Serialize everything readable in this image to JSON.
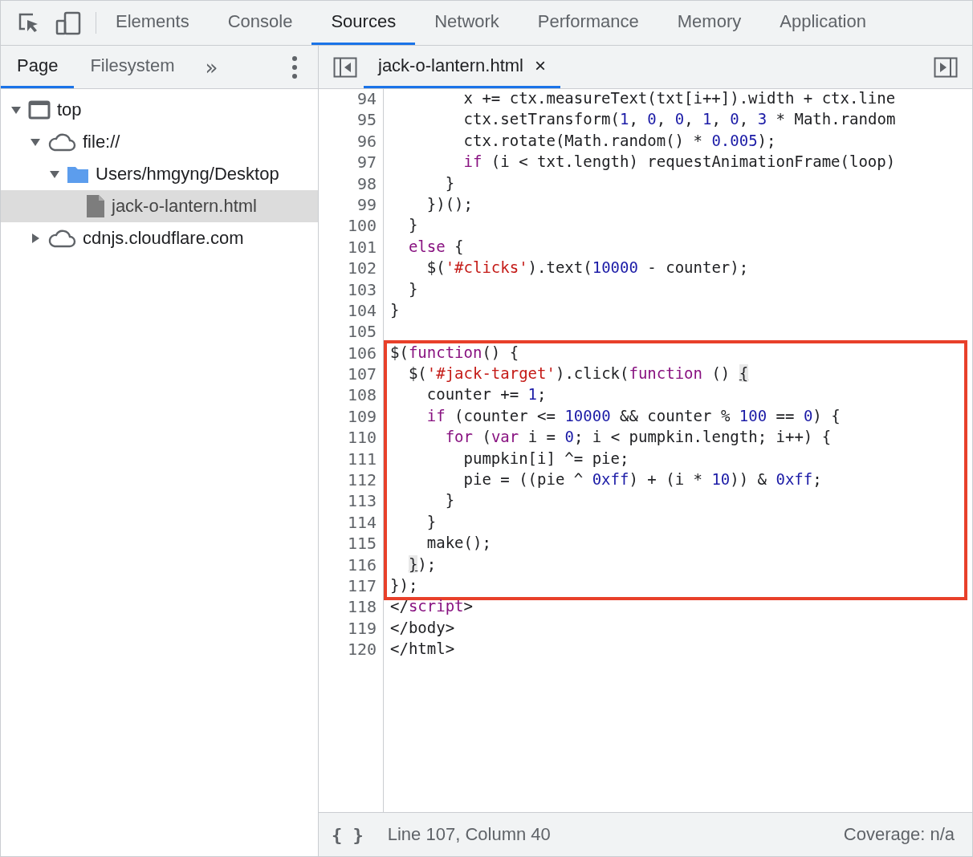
{
  "main_tabs": [
    {
      "label": "Elements",
      "selected": false
    },
    {
      "label": "Console",
      "selected": false
    },
    {
      "label": "Sources",
      "selected": true
    },
    {
      "label": "Network",
      "selected": false
    },
    {
      "label": "Performance",
      "selected": false
    },
    {
      "label": "Memory",
      "selected": false
    },
    {
      "label": "Application",
      "selected": false
    }
  ],
  "navigator_tabs": [
    {
      "label": "Page",
      "selected": true
    },
    {
      "label": "Filesystem",
      "selected": false
    }
  ],
  "more_tabs": "»",
  "tree": [
    {
      "label": "top",
      "kind": "frame",
      "expanded": true,
      "selected": false,
      "children": [
        {
          "label": "file://",
          "kind": "origin",
          "expanded": true,
          "selected": false,
          "children": [
            {
              "label": "Users/hmgyng/Desktop",
              "kind": "folder",
              "expanded": true,
              "selected": false,
              "children": [
                {
                  "label": "jack-o-lantern.html",
                  "kind": "file",
                  "selected": true
                }
              ]
            }
          ]
        },
        {
          "label": "cdnjs.cloudflare.com",
          "kind": "origin",
          "expanded": false,
          "selected": false
        }
      ]
    }
  ],
  "editor_tabs": [
    {
      "label": "jack-o-lantern.html",
      "close": "×",
      "selected": true
    }
  ],
  "code": {
    "lines_before": [
      {
        "number": "94",
        "tokens": [
          {
            "kind": "plain",
            "text": "        x += ctx.measureText(txt[i++]).width + ctx.line"
          }
        ]
      },
      {
        "number": "95",
        "tokens": [
          {
            "kind": "plain",
            "text": "        ctx.setTransform("
          },
          {
            "kind": "num",
            "text": "1"
          },
          {
            "kind": "plain",
            "text": ", "
          },
          {
            "kind": "num",
            "text": "0"
          },
          {
            "kind": "plain",
            "text": ", "
          },
          {
            "kind": "num",
            "text": "0"
          },
          {
            "kind": "plain",
            "text": ", "
          },
          {
            "kind": "num",
            "text": "1"
          },
          {
            "kind": "plain",
            "text": ", "
          },
          {
            "kind": "num",
            "text": "0"
          },
          {
            "kind": "plain",
            "text": ", "
          },
          {
            "kind": "num",
            "text": "3"
          },
          {
            "kind": "plain",
            "text": " * Math.random"
          }
        ]
      },
      {
        "number": "96",
        "tokens": [
          {
            "kind": "plain",
            "text": "        ctx.rotate(Math.random() * "
          },
          {
            "kind": "num",
            "text": "0.005"
          },
          {
            "kind": "plain",
            "text": ");"
          }
        ]
      },
      {
        "number": "97",
        "tokens": [
          {
            "kind": "kw",
            "text": "        if"
          },
          {
            "kind": "plain",
            "text": " (i < txt.length) requestAnimationFrame(loop)"
          }
        ]
      },
      {
        "number": "98",
        "tokens": [
          {
            "kind": "plain",
            "text": "      }"
          }
        ]
      },
      {
        "number": "99",
        "tokens": [
          {
            "kind": "plain",
            "text": "    })();"
          }
        ]
      },
      {
        "number": "100",
        "tokens": [
          {
            "kind": "plain",
            "text": "  }"
          }
        ]
      },
      {
        "number": "101",
        "tokens": [
          {
            "kind": "kw",
            "text": "  else"
          },
          {
            "kind": "plain",
            "text": " {"
          }
        ]
      },
      {
        "number": "102",
        "tokens": [
          {
            "kind": "plain",
            "text": "    $("
          },
          {
            "kind": "str",
            "text": "'#clicks'"
          },
          {
            "kind": "plain",
            "text": ").text("
          },
          {
            "kind": "num",
            "text": "10000"
          },
          {
            "kind": "plain",
            "text": " - counter);"
          }
        ]
      },
      {
        "number": "103",
        "tokens": [
          {
            "kind": "plain",
            "text": "  }"
          }
        ]
      },
      {
        "number": "104",
        "tokens": [
          {
            "kind": "plain",
            "text": "}"
          }
        ]
      },
      {
        "number": "105"
      }
    ],
    "highlighted_lines": [
      {
        "number": "106",
        "tokens": [
          {
            "kind": "plain",
            "text": "$("
          },
          {
            "kind": "kw",
            "text": "function"
          },
          {
            "kind": "plain",
            "text": "() {"
          }
        ]
      },
      {
        "number": "107",
        "tokens": [
          {
            "kind": "plain",
            "text": "  $("
          },
          {
            "kind": "str",
            "text": "'#jack-target'"
          },
          {
            "kind": "plain",
            "text": ").click("
          },
          {
            "kind": "kw",
            "text": "function"
          },
          {
            "kind": "plain",
            "text": " () "
          },
          {
            "kind": "match",
            "text": "{"
          }
        ]
      },
      {
        "number": "108",
        "tokens": [
          {
            "kind": "plain",
            "text": "    counter += "
          },
          {
            "kind": "num",
            "text": "1"
          },
          {
            "kind": "plain",
            "text": ";"
          }
        ]
      },
      {
        "number": "109",
        "tokens": [
          {
            "kind": "kw",
            "text": "    if"
          },
          {
            "kind": "plain",
            "text": " (counter <= "
          },
          {
            "kind": "num",
            "text": "10000"
          },
          {
            "kind": "plain",
            "text": " && counter % "
          },
          {
            "kind": "num",
            "text": "100"
          },
          {
            "kind": "plain",
            "text": " == "
          },
          {
            "kind": "num",
            "text": "0"
          },
          {
            "kind": "plain",
            "text": ") {"
          }
        ]
      },
      {
        "number": "110",
        "tokens": [
          {
            "kind": "kw",
            "text": "      for"
          },
          {
            "kind": "plain",
            "text": " ("
          },
          {
            "kind": "kw",
            "text": "var"
          },
          {
            "kind": "plain",
            "text": " i = "
          },
          {
            "kind": "num",
            "text": "0"
          },
          {
            "kind": "plain",
            "text": "; i < pumpkin.length; i++) {"
          }
        ]
      },
      {
        "number": "111",
        "tokens": [
          {
            "kind": "plain",
            "text": "        pumpkin[i] ^= pie;"
          }
        ]
      },
      {
        "number": "112",
        "tokens": [
          {
            "kind": "plain",
            "text": "        pie = ((pie ^ "
          },
          {
            "kind": "num",
            "text": "0xff"
          },
          {
            "kind": "plain",
            "text": ") + (i * "
          },
          {
            "kind": "num",
            "text": "10"
          },
          {
            "kind": "plain",
            "text": ")) & "
          },
          {
            "kind": "num",
            "text": "0xff"
          },
          {
            "kind": "plain",
            "text": ";"
          }
        ]
      },
      {
        "number": "113",
        "tokens": [
          {
            "kind": "plain",
            "text": "      }"
          }
        ]
      },
      {
        "number": "114",
        "tokens": [
          {
            "kind": "plain",
            "text": "    }"
          }
        ]
      },
      {
        "number": "115",
        "tokens": [
          {
            "kind": "plain",
            "text": "    make();"
          }
        ]
      },
      {
        "number": "116",
        "tokens": [
          {
            "kind": "match",
            "text": "  }"
          },
          {
            "kind": "plain",
            "text": ");"
          }
        ]
      },
      {
        "number": "117",
        "tokens": [
          {
            "kind": "plain",
            "text": "});"
          }
        ]
      }
    ],
    "lines_after": [
      {
        "number": "118",
        "tokens": [
          {
            "kind": "plain",
            "text": "</"
          },
          {
            "kind": "kw",
            "text": "script"
          },
          {
            "kind": "plain",
            "text": ">"
          }
        ]
      },
      {
        "number": "119",
        "tokens": [
          {
            "kind": "plain",
            "text": "</body>"
          }
        ]
      },
      {
        "number": "120",
        "tokens": [
          {
            "kind": "plain",
            "text": "</html>"
          }
        ]
      }
    ]
  },
  "status_bar": {
    "format_button": "{ }",
    "position": "Line 107, Column 40",
    "coverage": "Coverage: n/a"
  }
}
